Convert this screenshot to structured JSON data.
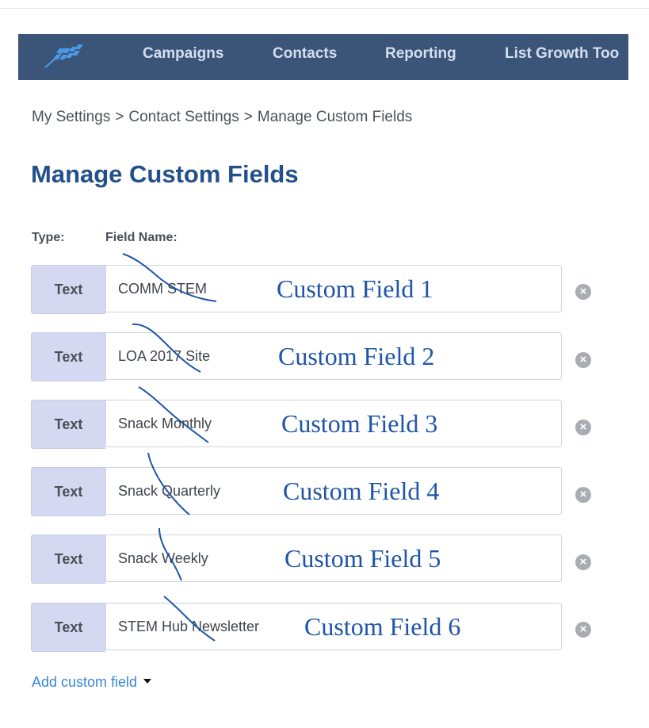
{
  "nav": {
    "items": [
      "Campaigns",
      "Contacts",
      "Reporting",
      "List Growth Too"
    ],
    "logo_icon": "logo-icon"
  },
  "breadcrumb": {
    "items": [
      "My Settings",
      "Contact Settings",
      "Manage Custom Fields"
    ],
    "separator": ">"
  },
  "page_title": "Manage Custom Fields",
  "columns": {
    "type_label": "Type:",
    "name_label": "Field Name:"
  },
  "fields": [
    {
      "type": "Text",
      "name": "COMM STEM",
      "annotation": "Custom Field 1"
    },
    {
      "type": "Text",
      "name": "LOA 2017 Site",
      "annotation": "Custom Field 2"
    },
    {
      "type": "Text",
      "name": "Snack Monthly",
      "annotation": "Custom Field 3"
    },
    {
      "type": "Text",
      "name": "Snack Quarterly",
      "annotation": "Custom Field 4"
    },
    {
      "type": "Text",
      "name": "Snack Weekly",
      "annotation": "Custom Field 5"
    },
    {
      "type": "Text",
      "name": "STEM Hub Newsletter",
      "annotation": "Custom Field 6"
    }
  ],
  "remove_icon": "remove-circle-icon",
  "add_link": "Add custom field",
  "colors": {
    "nav_bg": "#3b5578",
    "title": "#23508a",
    "link": "#3a86d6",
    "type_bg": "#d4d9f1",
    "annotation": "#1f55a8"
  }
}
